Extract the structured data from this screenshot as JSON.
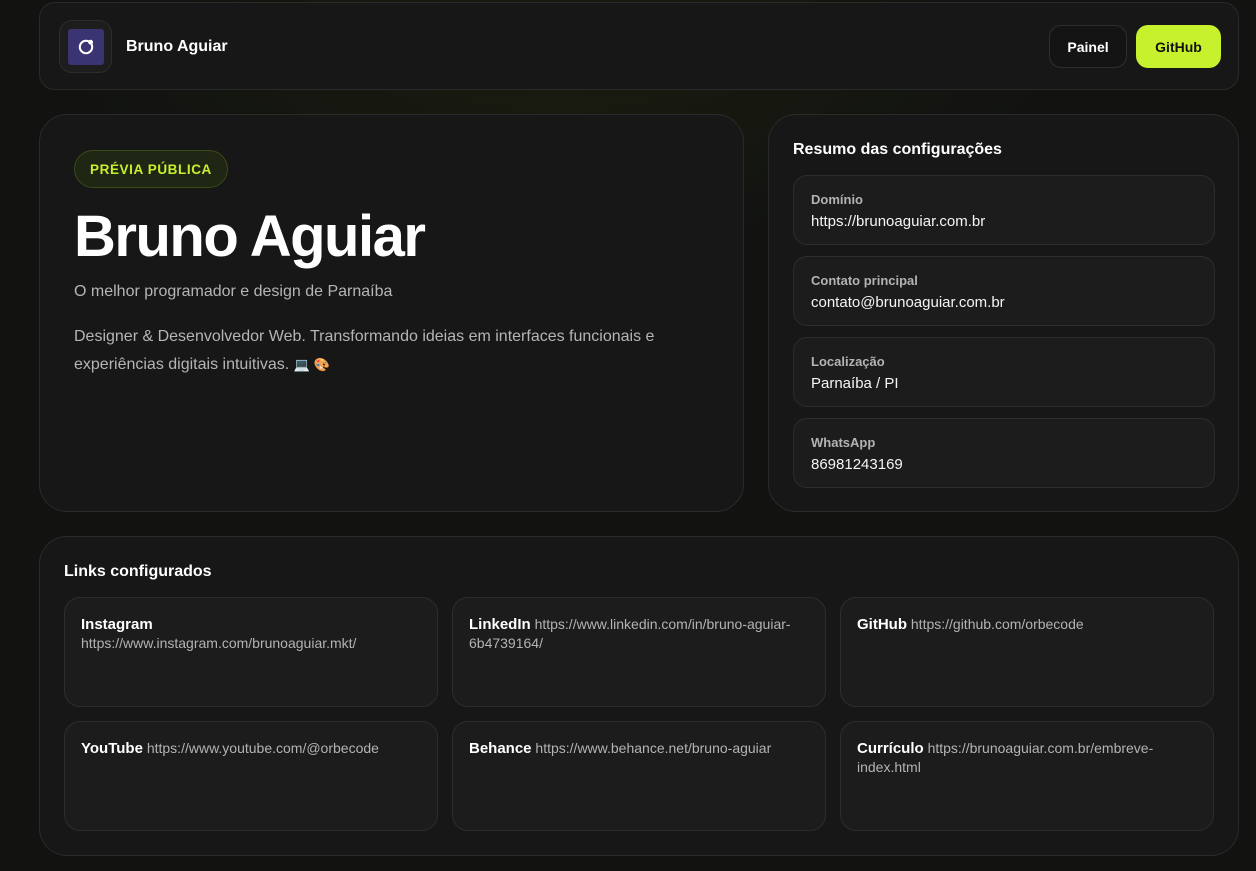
{
  "header": {
    "brand": "Bruno Aguiar",
    "painel_label": "Painel",
    "github_label": "GitHub"
  },
  "hero": {
    "badge": "PRÉVIA PÚBLICA",
    "title": "Bruno Aguiar",
    "subtitle": "O melhor programador e design de Parnaíba",
    "description": "Designer & Desenvolvedor Web. Transformando ideias em interfaces funcionais e experiências digitais intuitivas.",
    "description_emoji": "💻 🎨"
  },
  "summary": {
    "title": "Resumo das configurações",
    "fields": [
      {
        "label": "Domínio",
        "value": "https://brunoaguiar.com.br"
      },
      {
        "label": "Contato principal",
        "value": "contato@brunoaguiar.com.br"
      },
      {
        "label": "Localização",
        "value": "Parnaíba / PI"
      },
      {
        "label": "WhatsApp",
        "value": "86981243169"
      }
    ]
  },
  "links": {
    "title": "Links configurados",
    "items": [
      {
        "name": "Instagram",
        "url": "https://www.instagram.com/brunoaguiar.mkt/"
      },
      {
        "name": "LinkedIn",
        "url": "https://www.linkedin.com/in/bruno-aguiar-6b4739164/"
      },
      {
        "name": "GitHub",
        "url": "https://github.com/orbecode"
      },
      {
        "name": "YouTube",
        "url": "https://www.youtube.com/@orbecode"
      },
      {
        "name": "Behance",
        "url": "https://www.behance.net/bruno-aguiar"
      },
      {
        "name": "Currículo",
        "url": "https://brunoaguiar.com.br/embreve-index.html"
      }
    ]
  },
  "colors": {
    "accent": "#c6f12c",
    "background": "#121311",
    "card": "#171717",
    "logo": "#3b3473"
  },
  "icons": {
    "logo": "orbit-logo-icon"
  }
}
